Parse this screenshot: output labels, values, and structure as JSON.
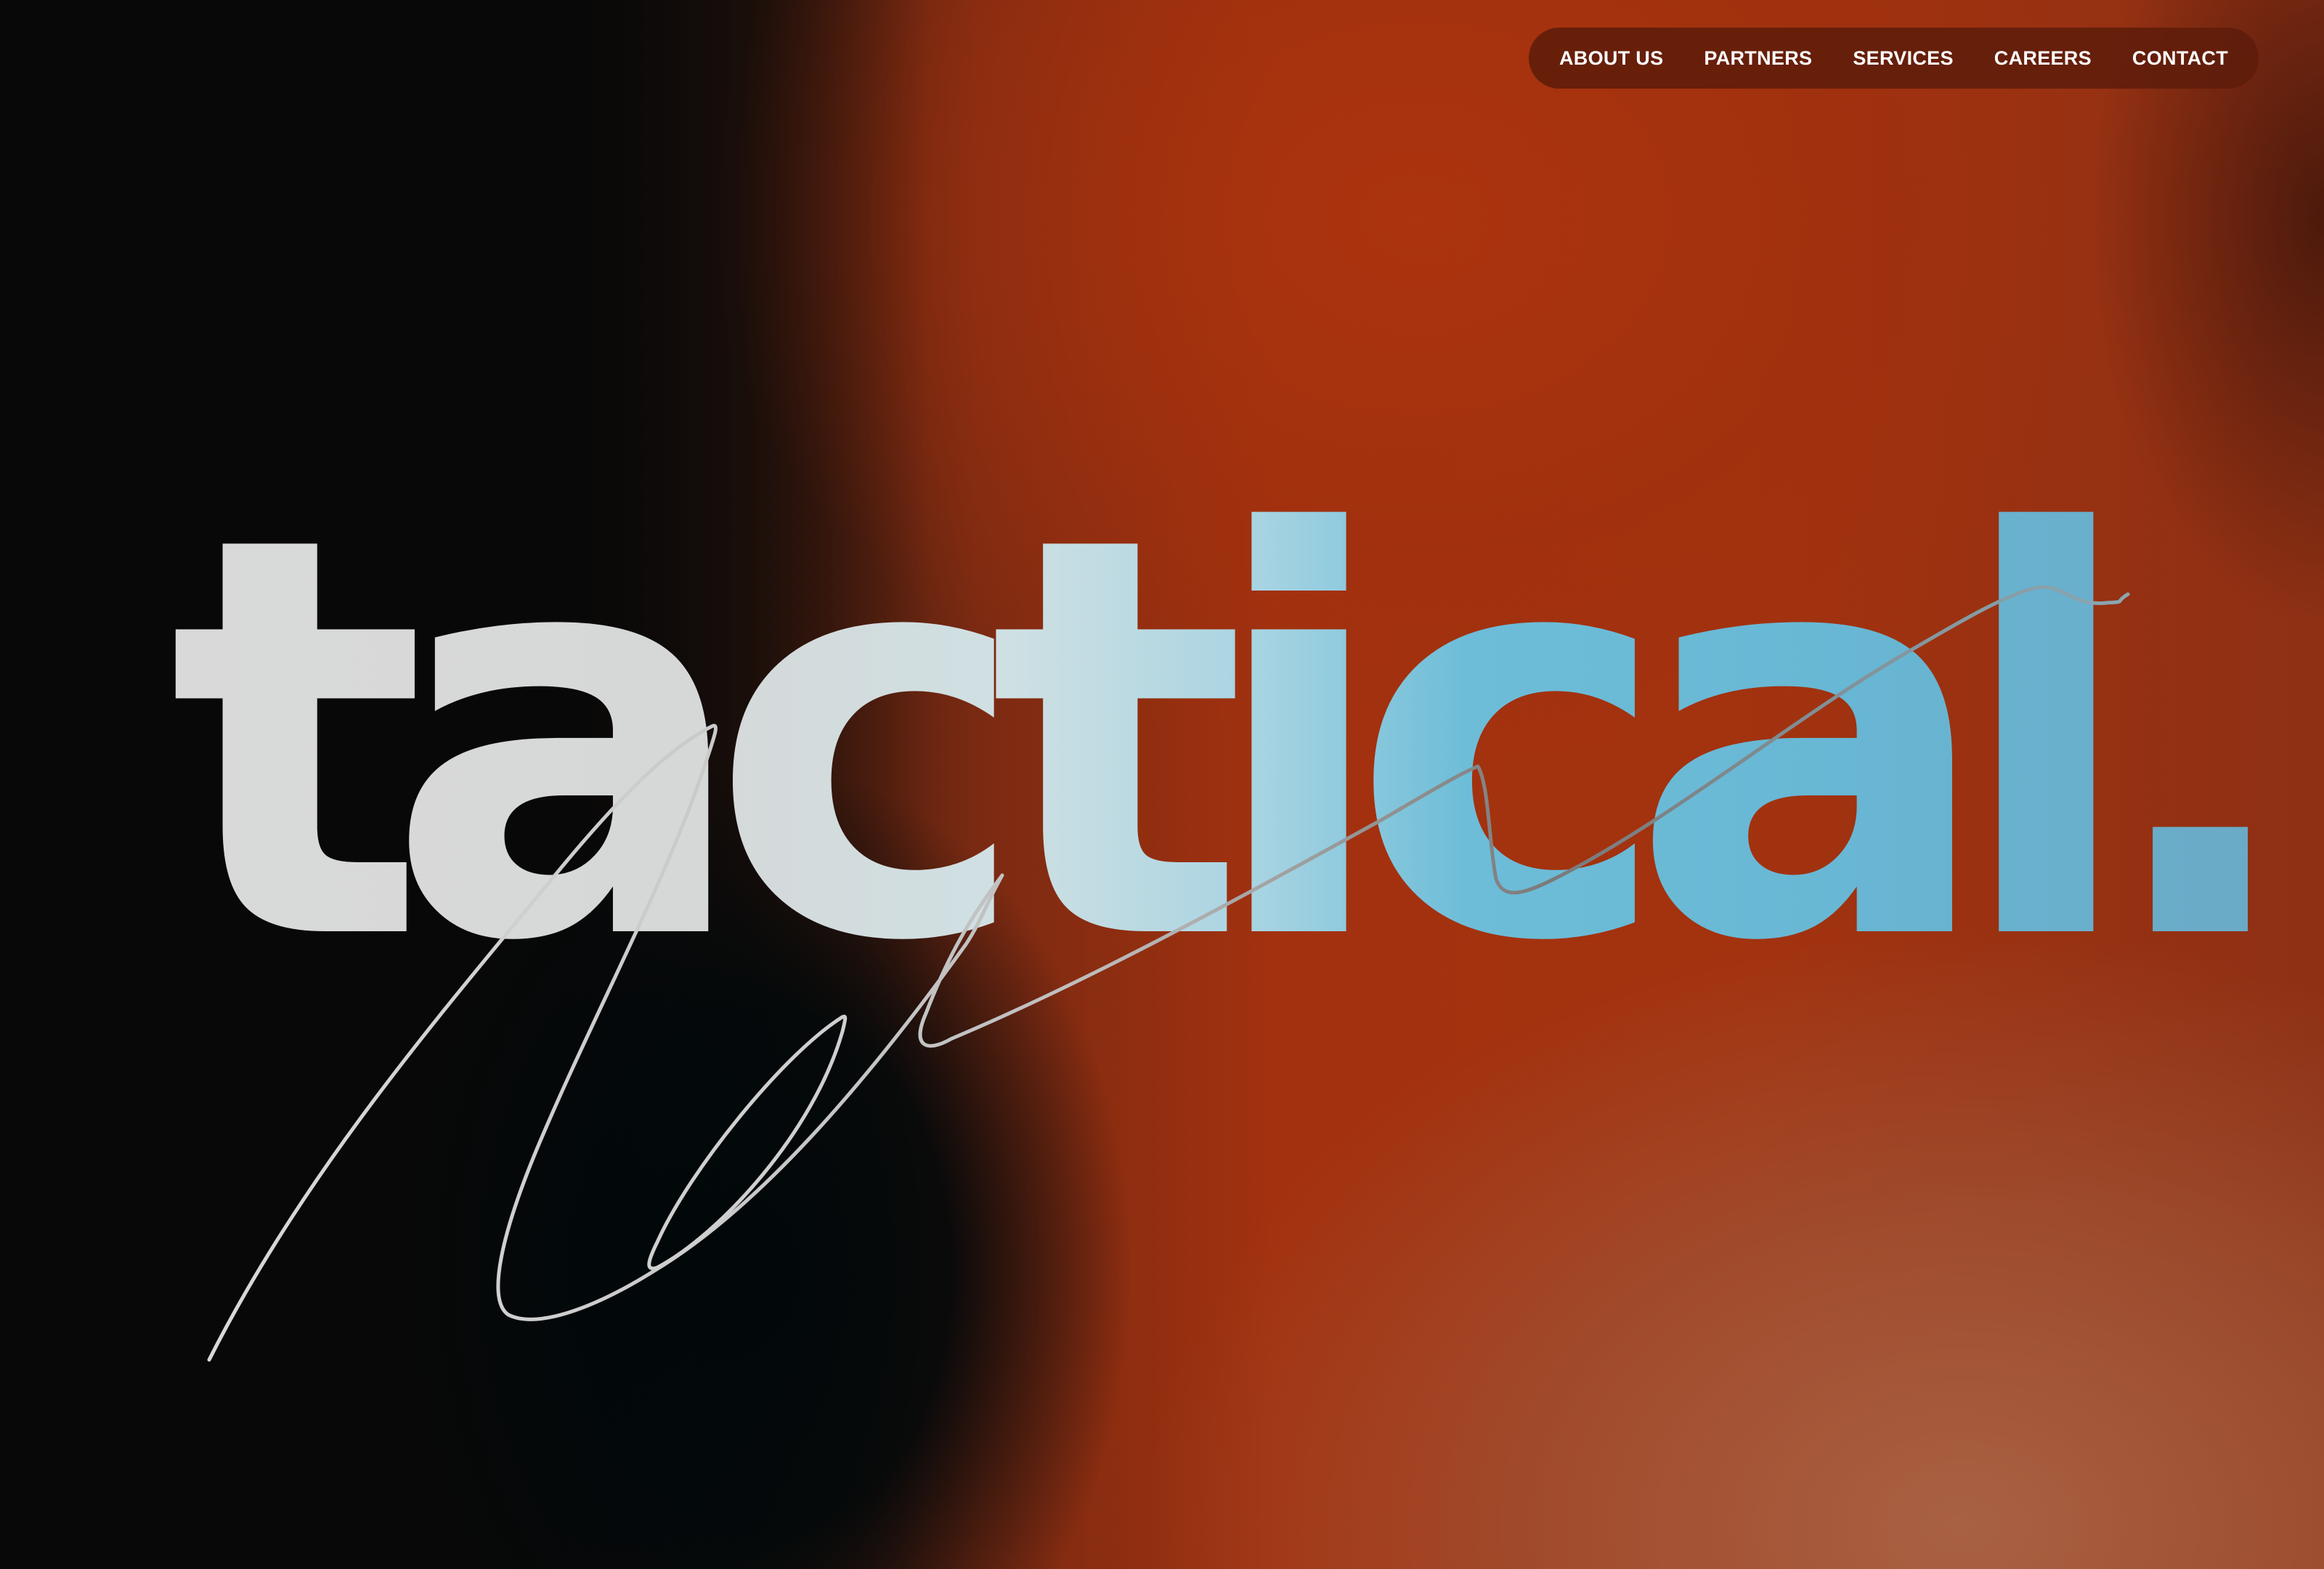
{
  "nav": {
    "items": [
      {
        "label": "ABOUT US"
      },
      {
        "label": "PARTNERS"
      },
      {
        "label": "SERVICES"
      },
      {
        "label": "CAREERS"
      },
      {
        "label": "CONTACT"
      }
    ]
  },
  "hero": {
    "wordmark": "tactical."
  },
  "colors": {
    "background_dark": "#0a0a0a",
    "background_accent": "#a3320f",
    "wordmark_light": "#d9d9d9",
    "wordmark_blue": "#68b7d4",
    "nav_pill": "#5f1c0a"
  }
}
